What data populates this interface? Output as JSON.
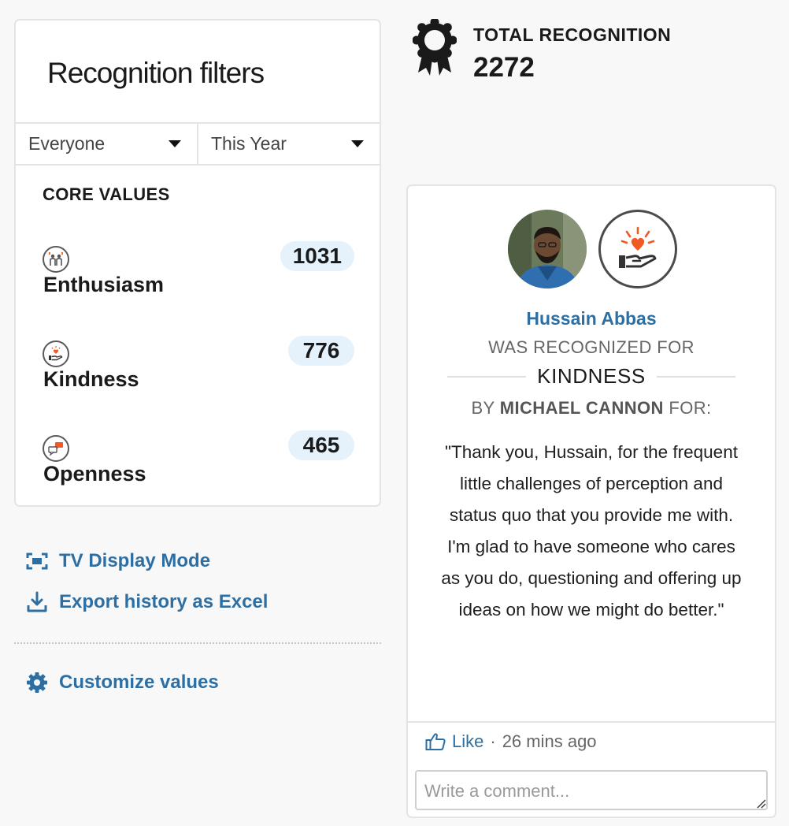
{
  "filters": {
    "title": "Recognition filters",
    "people_select": "Everyone",
    "period_select": "This Year",
    "core_values_heading": "CORE VALUES",
    "values": [
      {
        "label": "Enthusiasm",
        "count": "1031",
        "icon": "enthusiasm-icon"
      },
      {
        "label": "Kindness",
        "count": "776",
        "icon": "kindness-icon"
      },
      {
        "label": "Openness",
        "count": "465",
        "icon": "openness-icon"
      }
    ]
  },
  "actions": {
    "tv_mode": "TV Display Mode",
    "export": "Export history as Excel",
    "customize": "Customize values"
  },
  "total": {
    "label": "TOTAL RECOGNITION",
    "count": "2272"
  },
  "recognition": {
    "recipient": "Hussain Abbas",
    "recognized_for": "WAS RECOGNIZED FOR",
    "value": "KINDNESS",
    "by_prefix": "BY",
    "giver": "MICHAEL CANNON",
    "by_suffix": "FOR:",
    "message": "\"Thank you, Hussain, for the frequent little challenges of perception and status quo that you provide me with. I'm glad to have someone who cares as you do, questioning and offering up ideas on how we might do better.\"",
    "like_label": "Like",
    "separator": "·",
    "time_ago": "26 mins ago",
    "comment_placeholder": "Write a comment..."
  },
  "colors": {
    "link_blue": "#2e6fa3",
    "count_pill": "#e5f1fb",
    "accent_orange": "#f15a24"
  }
}
